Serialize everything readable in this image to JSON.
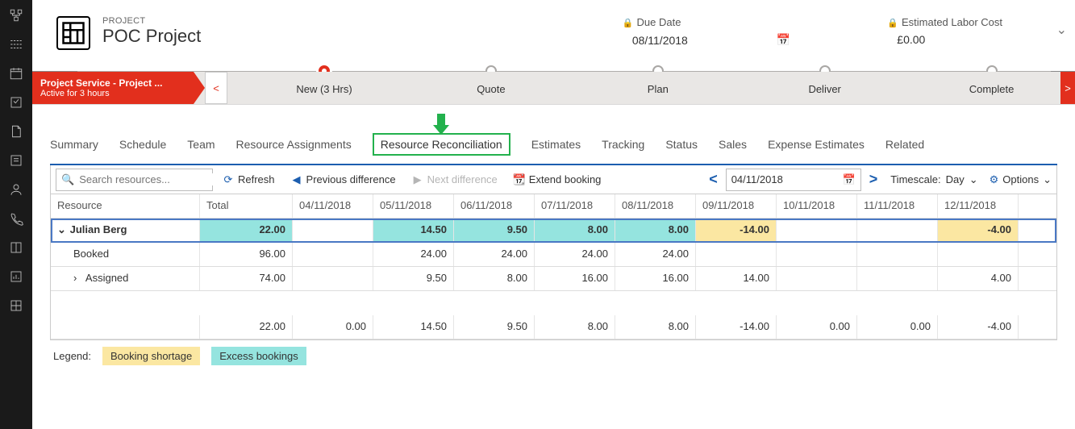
{
  "header": {
    "label": "PROJECT",
    "title": "POC Project",
    "due_label": "Due Date",
    "due_value": "08/11/2018",
    "cost_label": "Estimated Labor Cost",
    "cost_value": "£0.00"
  },
  "process": {
    "title": "Project Service - Project ...",
    "subtitle": "Active for 3 hours",
    "steps": {
      "s0": "New  (3 Hrs)",
      "s1": "Quote",
      "s2": "Plan",
      "s3": "Deliver",
      "s4": "Complete"
    }
  },
  "tabs": {
    "summary": "Summary",
    "schedule": "Schedule",
    "team": "Team",
    "ra": "Resource Assignments",
    "rr": "Resource Reconciliation",
    "estimates": "Estimates",
    "tracking": "Tracking",
    "status": "Status",
    "sales": "Sales",
    "expense": "Expense Estimates",
    "related": "Related"
  },
  "toolbar": {
    "search_ph": "Search resources...",
    "refresh": "Refresh",
    "prev": "Previous difference",
    "next": "Next difference",
    "extend": "Extend booking",
    "date": "04/11/2018",
    "timescale_lbl": "Timescale:",
    "timescale_val": "Day",
    "options": "Options"
  },
  "grid": {
    "head": {
      "resource": "Resource",
      "total": "Total",
      "d0": "04/11/2018",
      "d1": "05/11/2018",
      "d2": "06/11/2018",
      "d3": "07/11/2018",
      "d4": "08/11/2018",
      "d5": "09/11/2018",
      "d6": "10/11/2018",
      "d7": "11/11/2018",
      "d8": "12/11/2018"
    },
    "julian": {
      "name": "Julian Berg",
      "total": "22.00",
      "d0": "",
      "d1": "14.50",
      "d2": "9.50",
      "d3": "8.00",
      "d4": "8.00",
      "d5": "-14.00",
      "d6": "",
      "d7": "",
      "d8": "-4.00"
    },
    "booked": {
      "name": "Booked",
      "total": "96.00",
      "d0": "",
      "d1": "24.00",
      "d2": "24.00",
      "d3": "24.00",
      "d4": "24.00",
      "d5": "",
      "d6": "",
      "d7": "",
      "d8": ""
    },
    "assigned": {
      "name": "Assigned",
      "total": "74.00",
      "d0": "",
      "d1": "9.50",
      "d2": "8.00",
      "d3": "16.00",
      "d4": "16.00",
      "d5": "14.00",
      "d6": "",
      "d7": "",
      "d8": "4.00"
    },
    "totals": {
      "total": "22.00",
      "d0": "0.00",
      "d1": "14.50",
      "d2": "9.50",
      "d3": "8.00",
      "d4": "8.00",
      "d5": "-14.00",
      "d6": "0.00",
      "d7": "0.00",
      "d8": "-4.00"
    }
  },
  "legend": {
    "label": "Legend:",
    "shortage": "Booking shortage",
    "excess": "Excess bookings"
  }
}
